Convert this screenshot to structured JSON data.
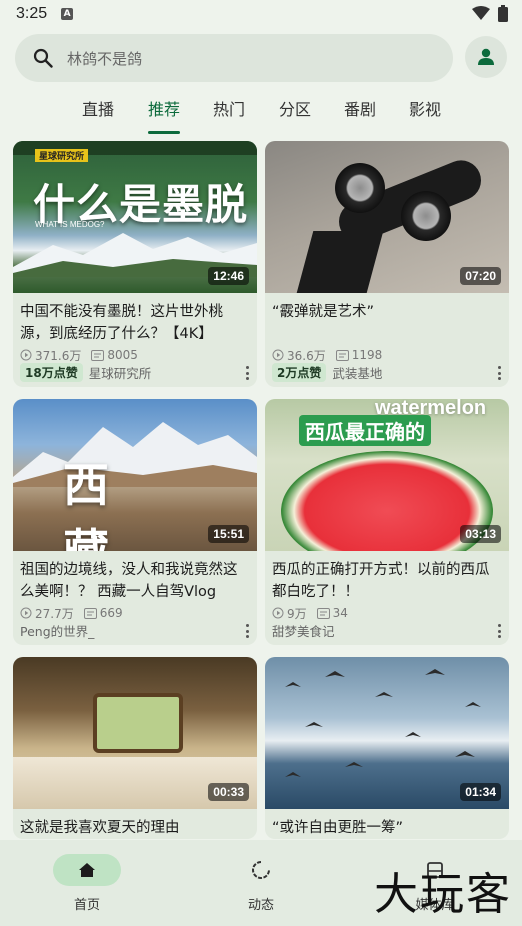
{
  "status": {
    "time": "3:25"
  },
  "search": {
    "placeholder": "林鸽不是鸽"
  },
  "tabs": [
    {
      "label": "直播"
    },
    {
      "label": "推荐",
      "active": true
    },
    {
      "label": "热门"
    },
    {
      "label": "分区"
    },
    {
      "label": "番剧"
    },
    {
      "label": "影视"
    }
  ],
  "videos": [
    {
      "thumb_text": "什么是墨脱",
      "thumb_sub": "WHAT IS MEDOG?",
      "thumb_channel": "星球研究所",
      "duration": "12:46",
      "title": "中国不能没有墨脱！这片世外桃源，到底经历了什么？【4K】",
      "views": "371.6万",
      "danmaku": "8005",
      "badge": "18万点赞",
      "author": "星球研究所"
    },
    {
      "duration": "07:20",
      "title": "“霰弹就是艺术”",
      "views": "36.6万",
      "danmaku": "1198",
      "badge": "2万点赞",
      "author": "武装基地"
    },
    {
      "thumb_text": "西 藏",
      "duration": "15:51",
      "title": "祖国的边境线，没人和我说竟然这么美啊！？ 西藏一人自驾Vlog",
      "views": "27.7万",
      "danmaku": "669",
      "author": "Peng的世界_"
    },
    {
      "thumb_text": "西瓜最正确的",
      "thumb_top": "watermelon",
      "duration": "03:13",
      "title": "西瓜的正确打开方式！以前的西瓜都白吃了！！",
      "views": "9万",
      "danmaku": "34",
      "author": "甜梦美食记"
    },
    {
      "duration": "00:33",
      "title": "这就是我喜欢夏天的理由"
    },
    {
      "duration": "01:34",
      "title": "“或许自由更胜一筹”"
    }
  ],
  "nav": [
    {
      "label": "首页",
      "icon": "home-icon",
      "active": true
    },
    {
      "label": "动态",
      "icon": "refresh-icon"
    },
    {
      "label": "媒体库",
      "icon": "library-icon"
    }
  ],
  "watermark": "大玩客",
  "colors": {
    "accent": "#0c6a3c",
    "background": "#eef3ec",
    "card": "#e2eadf",
    "badge": "#cfe7d0"
  }
}
